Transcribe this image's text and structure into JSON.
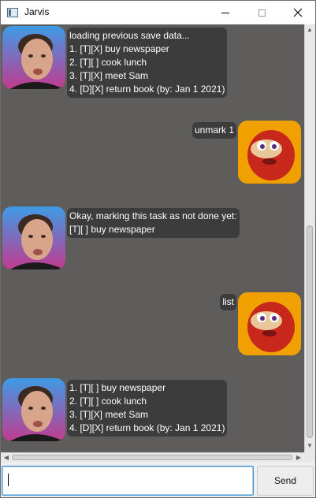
{
  "window": {
    "title": "Jarvis"
  },
  "dialogs": [
    {
      "speaker": "bot",
      "text": "loading previous save data...\n1. [T][X] buy newspaper\n2. [T][ ] cook lunch\n3. [T][X] meet Sam\n4. [D][X] return book (by: Jan 1 2021)"
    },
    {
      "speaker": "user",
      "text": "unmark 1"
    },
    {
      "speaker": "bot",
      "text": "Okay, marking this task as not done yet:\n[T][ ] buy newspaper"
    },
    {
      "speaker": "user",
      "text": "list"
    },
    {
      "speaker": "bot",
      "text": "1. [T][ ] buy newspaper\n2. [T][ ] cook lunch\n3. [T][X] meet Sam\n4. [D][X] return book (by: Jan 1 2021)"
    }
  ],
  "input": {
    "value": "",
    "placeholder": ""
  },
  "send_label": "Send",
  "colors": {
    "chat_background": "#5f5d5b",
    "bubble": "#3c3c3c",
    "bubble_text": "#ffffff",
    "focus_border": "#3a92d4"
  },
  "icons": {
    "bot_avatar": "man-portrait-avatar",
    "user_avatar": "red-cartoon-character-avatar"
  }
}
